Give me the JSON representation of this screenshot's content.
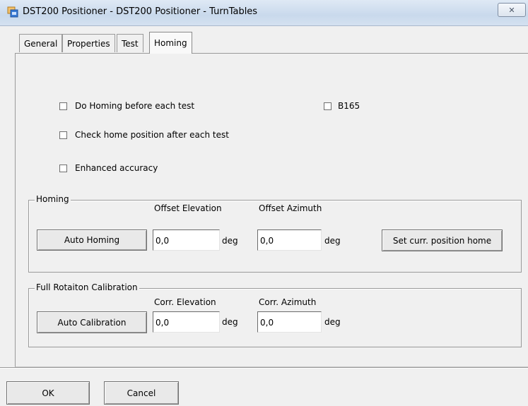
{
  "window": {
    "title": "DST200 Positioner - DST200 Positioner - TurnTables",
    "close_symbol": "✕"
  },
  "tabs": [
    {
      "label": "General"
    },
    {
      "label": "Properties"
    },
    {
      "label": "Test"
    },
    {
      "label": "Homing",
      "active": true
    }
  ],
  "options": {
    "do_homing": {
      "label": "Do Homing before each test",
      "checked": false
    },
    "b165": {
      "label": "B165",
      "checked": false
    },
    "check_home": {
      "label": "Check home position after each test",
      "checked": false
    },
    "enhanced_accuracy": {
      "label": "Enhanced accuracy",
      "checked": false
    }
  },
  "homing_group": {
    "title": "Homing",
    "offset_elevation_label": "Offset Elevation",
    "offset_azimuth_label": "Offset Azimuth",
    "auto_homing_button": "Auto Homing",
    "offset_elevation_value": "0,0",
    "offset_azimuth_value": "0,0",
    "unit": "deg",
    "set_home_button": "Set curr. position home"
  },
  "calibration_group": {
    "title": "Full Rotaiton Calibration",
    "corr_elevation_label": "Corr. Elevation",
    "corr_azimuth_label": "Corr. Azimuth",
    "auto_calibration_button": "Auto Calibration",
    "corr_elevation_value": "0,0",
    "corr_azimuth_value": "0,0",
    "unit": "deg"
  },
  "footer": {
    "ok_label": "OK",
    "cancel_label": "Cancel"
  }
}
